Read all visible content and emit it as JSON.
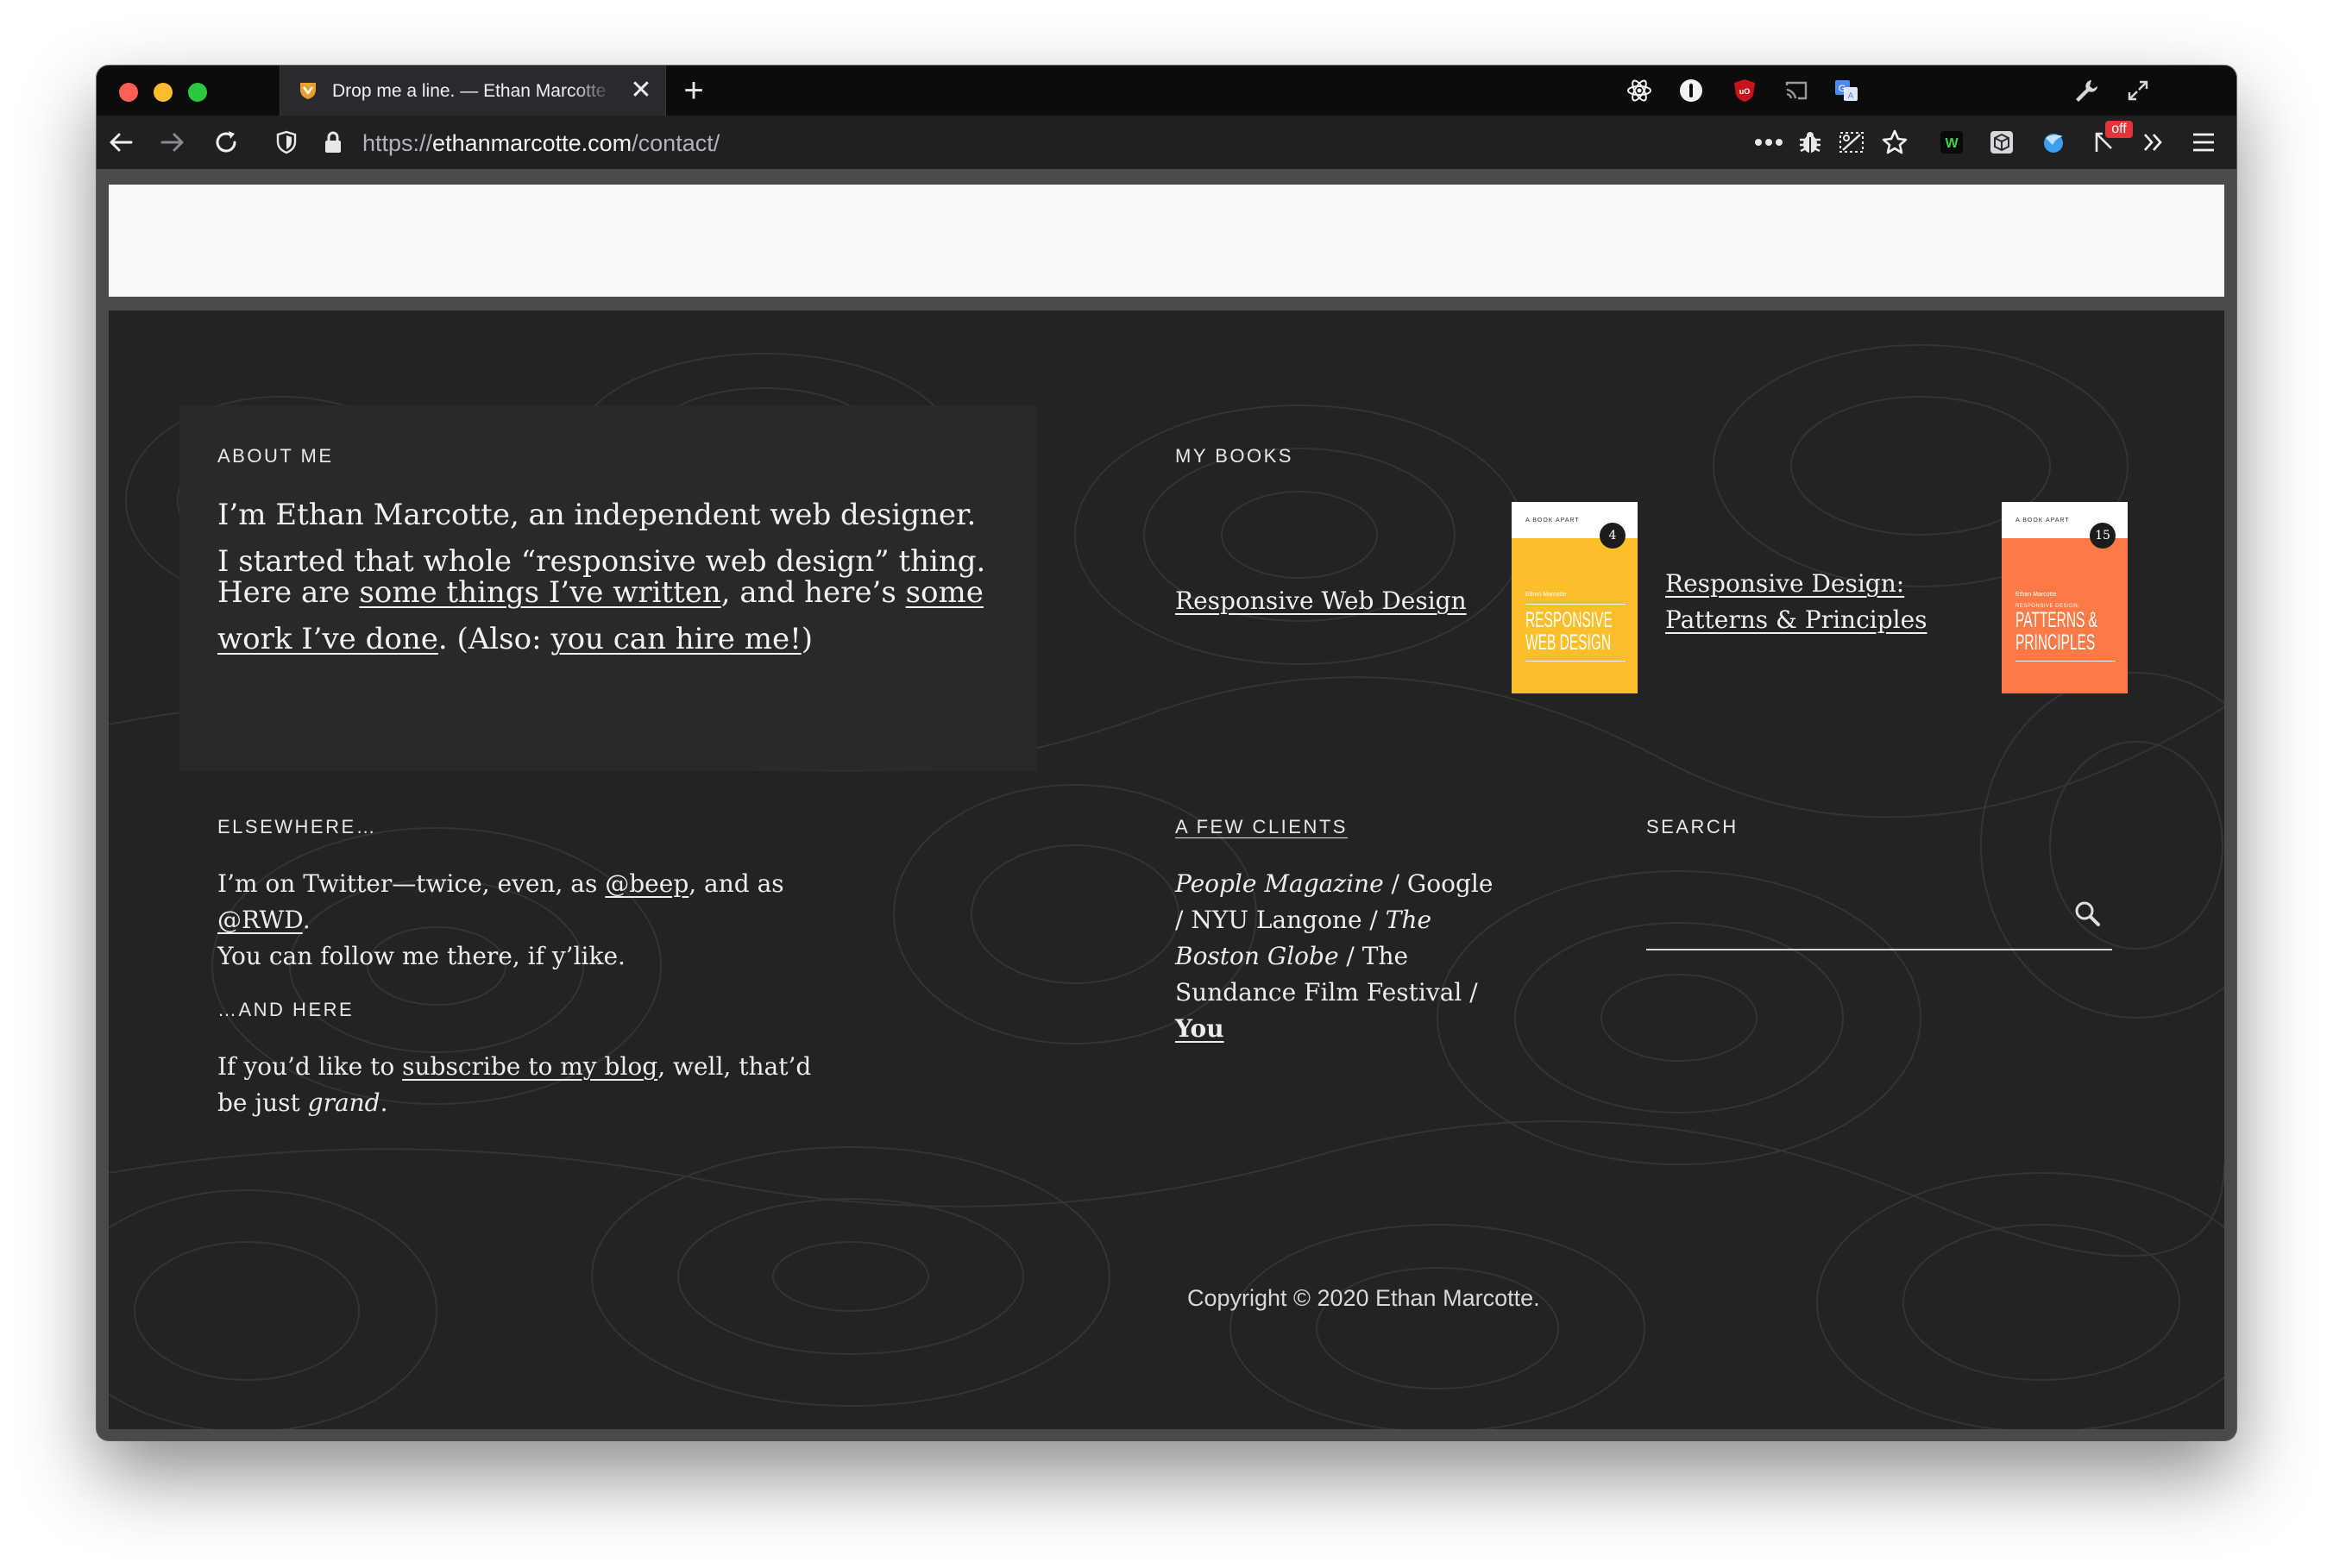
{
  "browser": {
    "tab_title": "Drop me a line. — Ethan Marcotte",
    "tab_close": "✕",
    "new_tab": "+",
    "url_scheme": "https://",
    "url_domain": "ethanmarcotte.com",
    "url_path": "/contact/",
    "badge_off": "off",
    "colors": {
      "tabbar": "#0c0c0d",
      "navbar": "#202023",
      "active_tab": "#2a2a2e"
    }
  },
  "footer": {
    "about": {
      "label": "ABOUT ME",
      "para1": "I’m Ethan Marcotte, an independent web designer. I started that whole “responsive web design” thing.",
      "p2_a": "Here are ",
      "p2_link1": "some things I’ve written",
      "p2_b": ", and here’s ",
      "p2_link2": "some work I’ve done",
      "p2_c": ". (Also: ",
      "p2_link3": "you can hire me!",
      "p2_d": ")"
    },
    "books": {
      "label": "MY BOOKS",
      "items": [
        {
          "title": "Responsive Web Design",
          "publisher": "A BOOK APART",
          "number": "4",
          "author": "Ethan Marcotte",
          "cover_text": "RESPONSIVE WEB DESIGN",
          "cover_line1": "RESPONSIVE",
          "cover_line2": "WEB DESIGN",
          "color": "#fbbf2b"
        },
        {
          "title": "Responsive Design: Patterns & Principles",
          "title_line1": "Responsive Design:",
          "title_line2": "Patterns & Principles",
          "publisher": "A BOOK APART",
          "number": "15",
          "author": "Ethan Marcotte",
          "cover_sub": "RESPONSIVE DESIGN:",
          "cover_line1": "PATTERNS &",
          "cover_line2": "PRINCIPLES",
          "color": "#fb7a48"
        }
      ]
    },
    "elsewhere": {
      "label": "ELSEWHERE…",
      "t_a": "I’m on Twitter—twice, even, as ",
      "link1": "@beep",
      "t_b": ", and as ",
      "link2": "@RWD",
      "t_c": ".",
      "t_d": "You can follow me there, if y’like."
    },
    "and_here": {
      "label": "…AND HERE",
      "t_a": "If you’d like to ",
      "link": "subscribe to my blog",
      "t_b": ", well, that’d be just ",
      "t_em": "grand",
      "t_c": "."
    },
    "clients": {
      "label": "A FEW CLIENTS",
      "c1": "People Magazine",
      "sep": " / ",
      "c2": "Google",
      "c3": "NYU Langone",
      "c4": "The Boston Globe",
      "c5": "The Sundance Film Festival",
      "c6": "You"
    },
    "search": {
      "label": "SEARCH",
      "placeholder": ""
    },
    "copyright": "Copyright © 2020 Ethan Marcotte."
  }
}
